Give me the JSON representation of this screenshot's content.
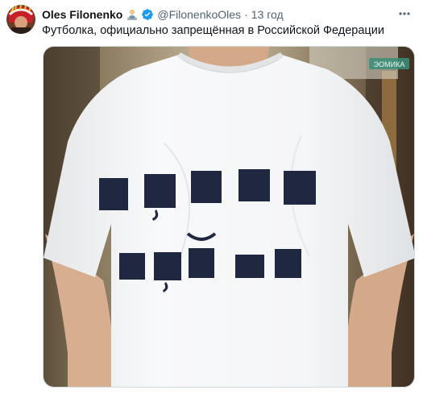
{
  "tweet": {
    "author_name": "Oles Filonenko",
    "badge_emoji": "person-at-desk-emoji",
    "verified_icon": "verified-badge-icon",
    "handle": "@FilonenkoOles",
    "separator": "·",
    "time": "13 год",
    "text": "Футболка, официально запрещённая в Российской Федерации",
    "more_icon": "more-options-icon"
  },
  "media": {
    "watermark": "ЭОМИКА",
    "shirt_rows": [
      {
        "glyphs": [
          "block",
          "block-comma",
          "block",
          "block",
          "block"
        ]
      },
      {
        "glyphs": [
          "block",
          "block-comma",
          "block-breve",
          "block",
          "block"
        ]
      }
    ]
  },
  "colors": {
    "name": "#0f1419",
    "muted": "#536471",
    "verified": "#1d9bf0",
    "shirt": "#f6f7f8",
    "print": "#1f2840"
  }
}
